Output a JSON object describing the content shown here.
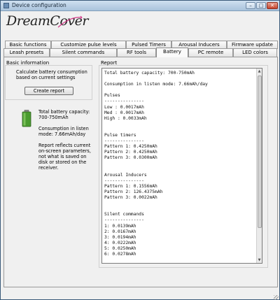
{
  "window": {
    "title": "Device configuration"
  },
  "logo": {
    "text": "DreamCover"
  },
  "tabs": {
    "row1": [
      "Basic functions",
      "Customize pulse levels",
      "Pulsed Timers",
      "Arousal Inducers",
      "Firmware update"
    ],
    "row2": [
      "Leash presets",
      "Silent commands",
      "RF tools",
      "Battery",
      "PC remote",
      "LED colors"
    ],
    "active": "Battery"
  },
  "basic_info": {
    "title": "Basic information",
    "description": "Calculate battery consumption based on current settings",
    "create_button": "Create report",
    "capacity": "Total battery capacity: 700-750mAh",
    "consumption": "Consumption in listen mode: 7.66mAh/day",
    "note": "Report reflects current on-screen parameters, not what is saved on disk or stored on the receiver."
  },
  "report": {
    "title": "Report",
    "content": "Total battery capacity: 700-750mAh\n\nConsumption in listen mode: 7.66mAh/day\n\nPulses\n---------------\nLow : 0.0017mAh\nMed : 0.0017mAh\nHigh : 0.0033mAh\n\n\nPulse timers\n---------------\nPattern 1: 0.4250mAh\nPattern 2: 0.4250mAh\nPattern 3: 0.0300mAh\n\n\nArousal Inducers\n---------------\nPattern 1: 0.1556mAh\nPattern 2: 126.4375mAh\nPattern 3: 0.0022mAh\n\n\nSilent commands\n---------------\n1: 0.0139mAh\n2: 0.0167mAh\n3: 0.0194mAh\n4: 0.0222mAh\n5: 0.0250mAh\n6: 0.0278mAh"
  },
  "icons": {
    "battery": "battery-icon",
    "app": "app-icon"
  },
  "colors": {
    "title_bar": "#a9c3dc",
    "battery_green": "#4a9b2f",
    "close_button": "#c6452d"
  }
}
